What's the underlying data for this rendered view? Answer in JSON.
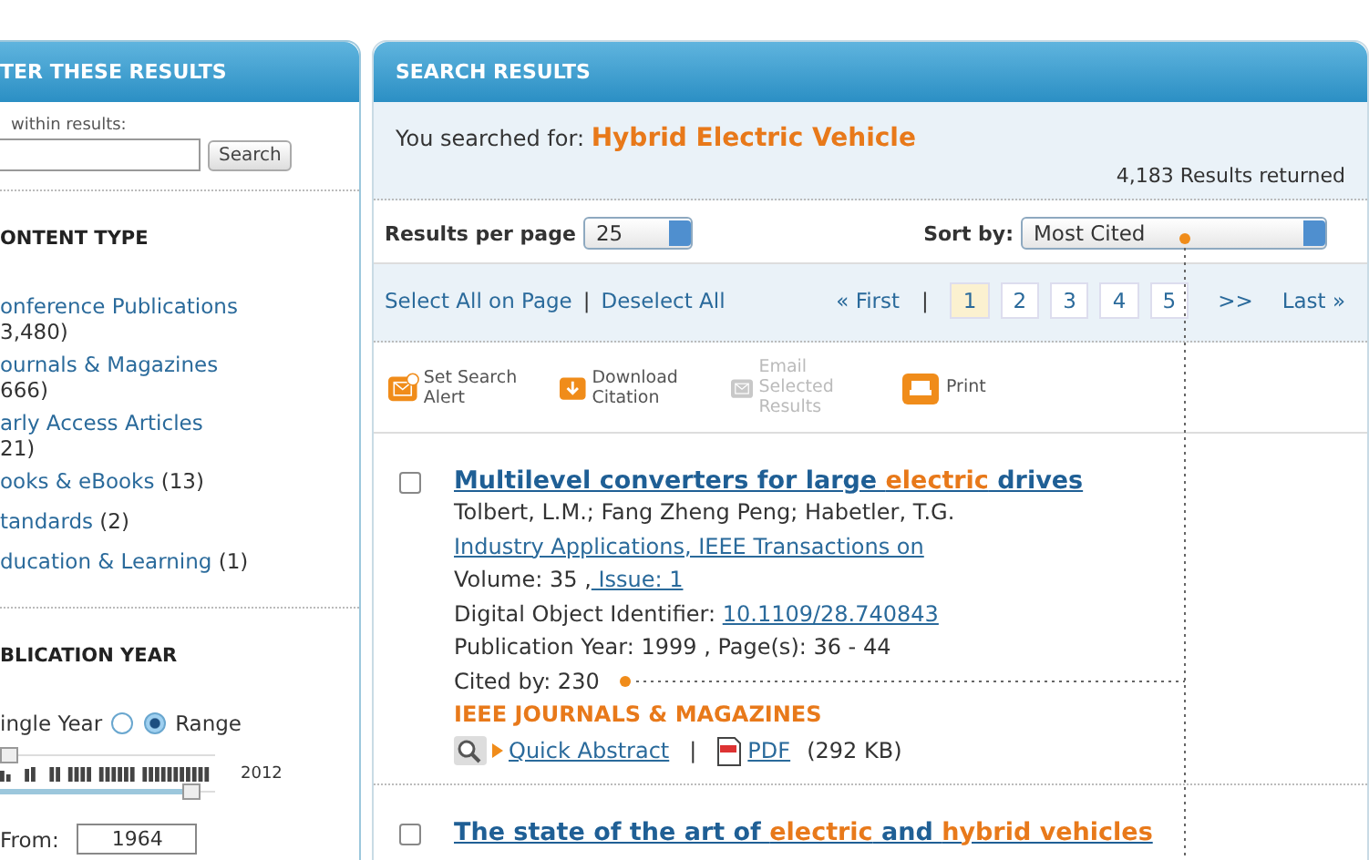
{
  "filter_panel": {
    "title": "TER THESE RESULTS",
    "search_label": "within results:",
    "search_button": "Search",
    "content_type": {
      "heading": "ONTENT TYPE",
      "items": [
        {
          "label": "onference Publications",
          "count": "3,480)",
          "wrap": true
        },
        {
          "label": "ournals & Magazines",
          "count": "666)",
          "wrap": true
        },
        {
          "label": "arly Access Articles",
          "count": "21)",
          "wrap": true
        },
        {
          "label": "ooks & eBooks",
          "count": "(13)",
          "wrap": false
        },
        {
          "label": "tandards",
          "count": "(2)",
          "wrap": false
        },
        {
          "label": "ducation & Learning",
          "count": "(1)",
          "wrap": false
        }
      ]
    },
    "publication_year": {
      "heading": "BLICATION YEAR",
      "modes": [
        {
          "label": "ingle Year",
          "selected": false
        },
        {
          "label": "Range",
          "selected": true
        }
      ],
      "slider": {
        "handles": [
          {
            "level": 0
          },
          {
            "level": 0.93
          }
        ],
        "max_label": "2012"
      },
      "from_label": "From:",
      "from_value": "1964"
    }
  },
  "results_panel": {
    "title": "SEARCH RESULTS",
    "searched_label": "You searched for:",
    "query": "Hybrid Electric Vehicle",
    "total": "4,183 Results returned",
    "per_page_label": "Results per page",
    "per_page": "25",
    "sort_label": "Sort by:",
    "sort": "Most Cited",
    "select_all": "Select All on Page",
    "separator": "|",
    "deselect_all": "Deselect All",
    "pagination": {
      "first": "« First",
      "separator": "|",
      "pages": [
        {
          "label": "1",
          "selected": true
        },
        {
          "label": "2",
          "selected": false
        },
        {
          "label": "3",
          "selected": false
        },
        {
          "label": "4",
          "selected": false
        },
        {
          "label": "5",
          "selected": false
        }
      ],
      "next": ">>",
      "last": "Last »"
    },
    "actions": [
      {
        "kind": "alert",
        "label": "Set Search Alert",
        "disabled": false
      },
      {
        "kind": "download",
        "label": "Download Citation",
        "disabled": false
      },
      {
        "kind": "email",
        "label": "Email Selected Results",
        "disabled": true
      },
      {
        "kind": "print",
        "label": "Print",
        "disabled": false
      }
    ],
    "results": [
      {
        "checked": false,
        "title": [
          {
            "text": "Multilevel converters for large ",
            "highlight": false
          },
          {
            "text": "electric",
            "highlight": true
          },
          {
            "text": " drives",
            "highlight": false
          }
        ],
        "authors": "Tolbert, L.M.; Fang Zheng Peng; Habetler, T.G.",
        "publication": "Industry Applications, IEEE Transactions on",
        "volume": "Volume: 35 ,",
        "issue": " Issue: 1",
        "doi_label": "Digital Object Identifier:",
        "doi": "10.1109/28.740843",
        "year_pages": "Publication Year: 1999 , Page(s): 36 - 44",
        "cited": "Cited by: 230",
        "type": "IEEE JOURNALS & MAGAZINES",
        "abstract": "Quick Abstract",
        "link_separator": "|",
        "pdf": "PDF",
        "pdf_size": "(292  KB)"
      },
      {
        "checked": false,
        "title": [
          {
            "text": "The state of the art of ",
            "highlight": false
          },
          {
            "text": "electric",
            "highlight": true
          },
          {
            "text": " and ",
            "highlight": false
          },
          {
            "text": "hybrid vehicles",
            "highlight": true
          }
        ]
      }
    ]
  }
}
